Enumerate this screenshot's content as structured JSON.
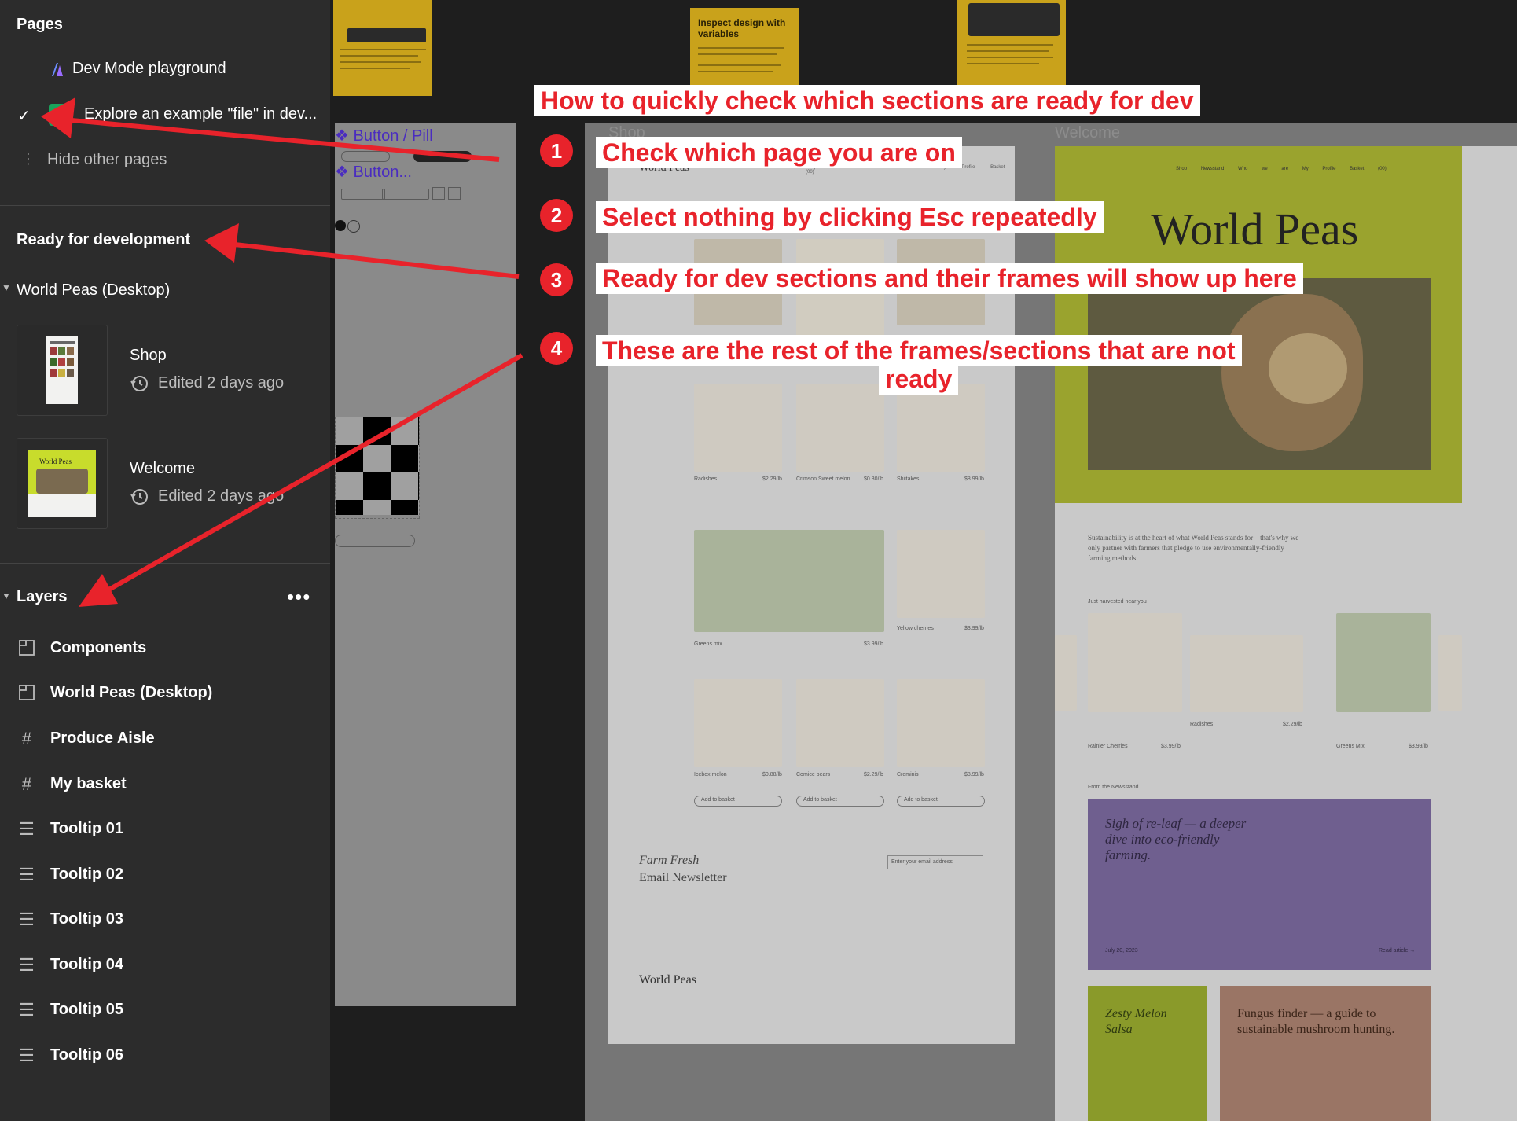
{
  "sidebar": {
    "pages_title": "Pages",
    "pages": [
      {
        "label": "Dev Mode playground"
      },
      {
        "label": "Explore an example \"file\" in dev..."
      }
    ],
    "hide_pages": "Hide other pages",
    "ready_title": "Ready for development",
    "section_title": "World Peas (Desktop)",
    "frames": [
      {
        "name": "Shop",
        "edited": "Edited 2 days ago"
      },
      {
        "name": "Welcome",
        "edited": "Edited 2 days ago"
      }
    ],
    "layers_title": "Layers",
    "layers": [
      {
        "label": "Components",
        "icon": "section-icon"
      },
      {
        "label": "World Peas (Desktop)",
        "icon": "section-icon"
      },
      {
        "label": "Produce Aisle",
        "icon": "frame-icon"
      },
      {
        "label": "My basket",
        "icon": "frame-icon"
      },
      {
        "label": "Tooltip 01",
        "icon": "text-lines-icon"
      },
      {
        "label": "Tooltip 02",
        "icon": "text-lines-icon"
      },
      {
        "label": "Tooltip 03",
        "icon": "text-lines-icon"
      },
      {
        "label": "Tooltip 04",
        "icon": "text-lines-icon"
      },
      {
        "label": "Tooltip 05",
        "icon": "text-lines-icon"
      },
      {
        "label": "Tooltip 06",
        "icon": "text-lines-icon"
      }
    ]
  },
  "annotations": {
    "headline": "How to quickly check which sections are ready for dev",
    "steps": [
      {
        "num": "1",
        "text": "Check which page you are on"
      },
      {
        "num": "2",
        "text": "Select nothing by clicking Esc repeatedly"
      },
      {
        "num": "3",
        "text": "Ready for dev sections and their frames will show up here"
      },
      {
        "num": "4",
        "text": "These are the rest of the frames/sections that are not",
        "text2": "ready"
      }
    ],
    "arrow_color": "#e8232b"
  },
  "canvas": {
    "tooltip_card": {
      "title": "Inspect design with variables",
      "color": "#c9a21b"
    },
    "components_labels": {
      "button_pill": "Button / Pill",
      "button": "Button..."
    },
    "shop_label": "Shop",
    "welcome_label": "Welcome",
    "shop_frame": {
      "brand": "World Peas",
      "nav": [
        "Shop",
        "Newsstand",
        "Who we are",
        "My Profile",
        "Basket (00)"
      ],
      "products": [
        {
          "name": "Radishes",
          "price": "$2.29/lb"
        },
        {
          "name": "Crimson Sweet melon",
          "price": "$0.80/lb"
        },
        {
          "name": "Shiitakes",
          "price": "$8.99/lb"
        },
        {
          "name": "Greens mix",
          "price": "$3.99/lb"
        },
        {
          "name": "Yellow cherries",
          "price": "$3.99/lb"
        },
        {
          "name": "Icebox melon",
          "price": "$0.88/lb"
        },
        {
          "name": "Comice pears",
          "price": "$2.29/lb"
        },
        {
          "name": "Creminis",
          "price": "$8.99/lb"
        }
      ],
      "add_label": "Add to basket",
      "newsletter": [
        "Farm Fresh",
        "Email Newsletter"
      ],
      "email_placeholder": "Enter your email address",
      "footer_brand": "World Peas"
    },
    "welcome_frame": {
      "brand": "World Peas",
      "nav": [
        "Shop",
        "Newsstand",
        "Who we are",
        "My Profile",
        "Basket (00)"
      ],
      "intro": "Sustainability is at the heart of what World Peas stands for—that's why we only partner with farmers that pledge to use environmentally-friendly farming methods.",
      "harvest_label": "Just harvested near you",
      "harvest_items": [
        {
          "name": "Rainier Cherries",
          "price": "$3.99/lb"
        },
        {
          "name": "Radishes",
          "price": "$2.29/lb"
        },
        {
          "name": "Greens Mix",
          "price": "$3.99/lb"
        }
      ],
      "newsstand_label": "From the Newsstand",
      "article_title": "Sigh of re-leaf — a deeper dive into eco-friendly farming.",
      "article_date": "July 20, 2023",
      "read_more": "Read article →",
      "card2_title": "Zesty Melon Salsa",
      "card3_title": "Fungus finder — a guide to sustainable mushroom hunting.",
      "lime": "#b9cc35",
      "purple": "#9c86c8",
      "salmon": "#d9a48a"
    }
  }
}
